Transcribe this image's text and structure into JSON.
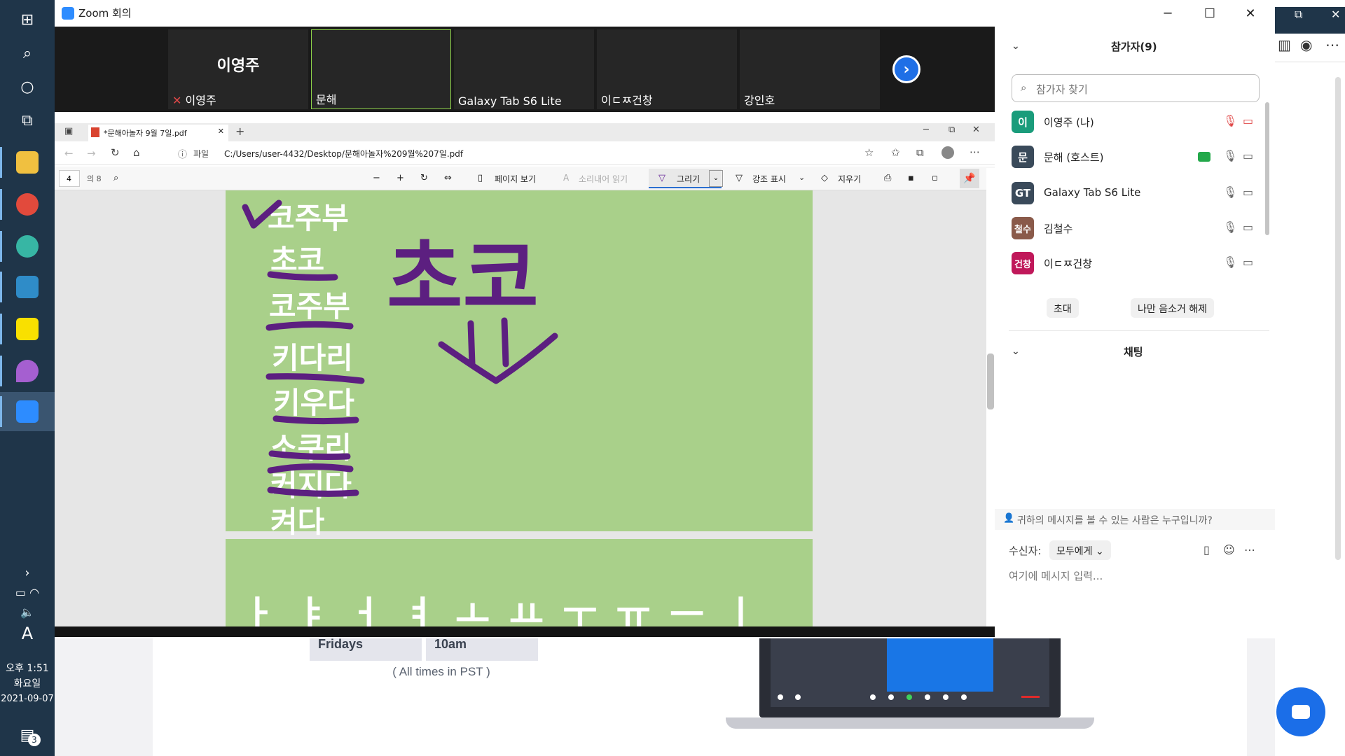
{
  "window": {
    "title": "Zoom 회의",
    "controls": [
      "─",
      "☐",
      "✕"
    ]
  },
  "video_strip": {
    "tiles": [
      {
        "name": "이영주",
        "display": "이영주",
        "muted": true
      },
      {
        "name": "문해",
        "display": "",
        "muted": false
      },
      {
        "name": "Galaxy Tab S6 Lite",
        "display": "",
        "muted": false
      },
      {
        "name": "이ㄷㅉ건창",
        "display": "",
        "muted": false
      },
      {
        "name": "강인호",
        "display": "",
        "muted": false
      }
    ],
    "next_glyph": "›"
  },
  "edge": {
    "tab_title": "*문해아놀자 9월 7일.pdf",
    "file_label": "파일",
    "address": "C:/Users/user-4432/Desktop/문해아놀자%209월%207일.pdf",
    "page_current": "4",
    "page_total": "의 8",
    "toolbar": {
      "page_view": "페이지 보기",
      "read_aloud": "소리내어 읽기",
      "draw": "그리기",
      "highlight": "강조 표시",
      "erase": "지우기"
    }
  },
  "pdf_page": {
    "words": [
      "코주부",
      "초코",
      "코주부",
      "키다리",
      "키우다",
      "소쿠리",
      "커지다",
      "켜다"
    ],
    "big_word": "초코",
    "next_page_row": "ㅏ ㅑ ㅓ ㅕ ㅗ ㅛ ㅜ ㅠ ㅡ ㅣ"
  },
  "participants": {
    "header": "참가자(9)",
    "search_placeholder": "참가자 찾기",
    "list": [
      {
        "avatar": "이",
        "name": "이영주 (나)",
        "color": "#1a9c7b",
        "mic": "muted",
        "video": "off"
      },
      {
        "avatar": "문",
        "name": "문해 (호스트)",
        "color": "#3a4a5a",
        "mic": "on",
        "video": "on",
        "sharing": true
      },
      {
        "avatar": "GT",
        "name": "Galaxy Tab S6 Lite",
        "color": "#3a4a5a",
        "mic": "on",
        "video": "on"
      },
      {
        "avatar": "철수",
        "name": "김철수",
        "color": "#8a5a4a",
        "mic": "on",
        "video": "on"
      },
      {
        "avatar": "건창",
        "name": "이ㄷㅉ건창",
        "color": "#c0185a",
        "mic": "on",
        "video": "on"
      }
    ],
    "invite_label": "초대",
    "unmute_label": "나만 음소거 해제"
  },
  "chat": {
    "header": "채팅",
    "visibility_note": "귀하의 메시지를 볼 수 있는 사람은 누구입니까?",
    "recipient_label": "수신자:",
    "recipient_value": "모두에게",
    "input_placeholder": "여기에 메시지 입력..."
  },
  "background_page": {
    "day": "Fridays",
    "time": "10am",
    "timezone_note": "( All times in PST )"
  },
  "taskbar": {
    "clock_time": "오후 1:51",
    "clock_day": "화요일",
    "clock_date": "2021-09-07",
    "ime": "A",
    "notification_count": "3"
  },
  "colors": {
    "page_green": "#a9d08a",
    "ink_purple": "#5c1f80",
    "zoom_blue": "#2d8cff"
  }
}
